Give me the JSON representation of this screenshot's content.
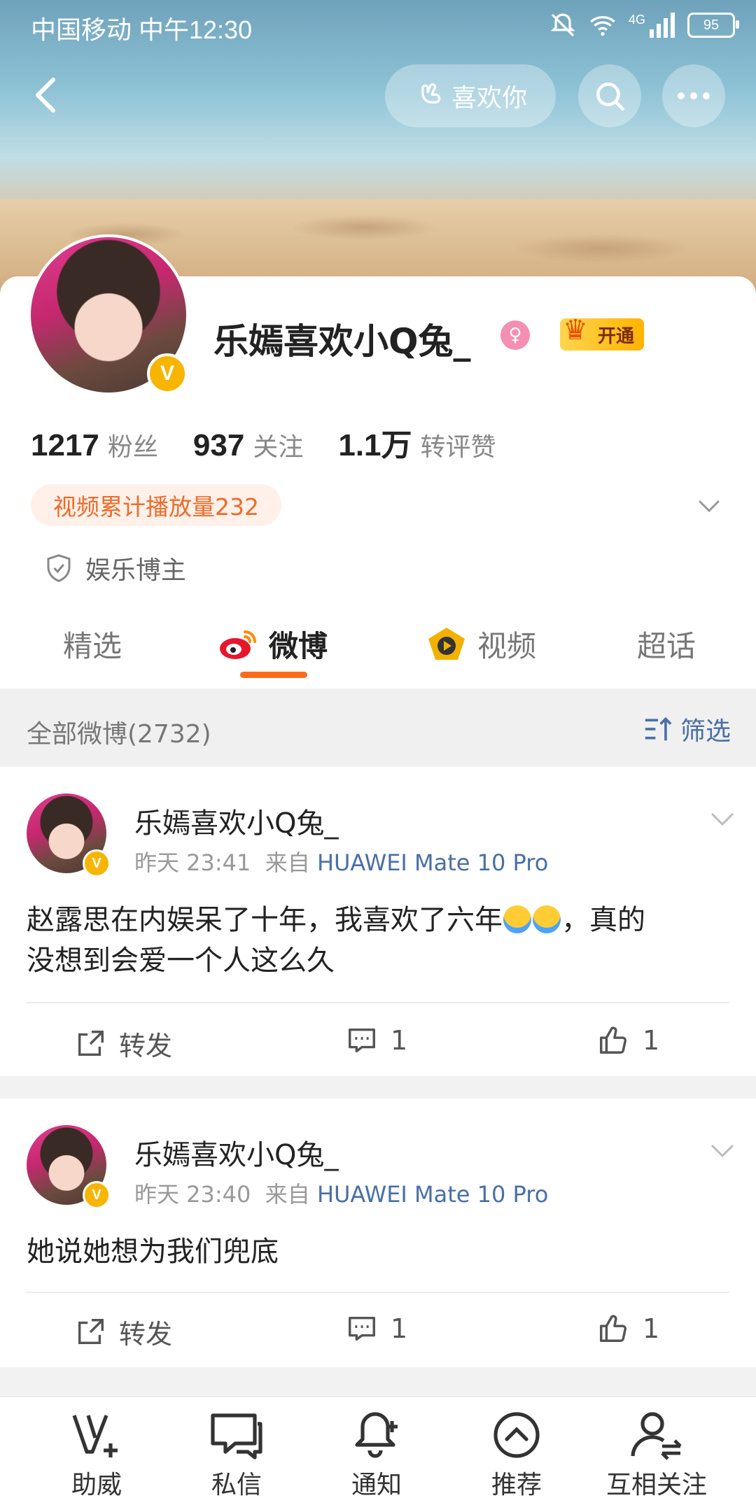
{
  "status": {
    "carrier_time": "中国移动 中午12:30",
    "battery": "95",
    "network": "4G"
  },
  "header": {
    "like_button": "喜欢你"
  },
  "profile": {
    "name": "乐嫣喜欢小Q兔_",
    "vip_label": "开通",
    "stats": [
      {
        "num": "1217",
        "label": "粉丝"
      },
      {
        "num": "937",
        "label": "关注"
      },
      {
        "num": "1.1万",
        "label": "转评赞"
      }
    ],
    "video_plays": "视频累计播放量232",
    "category": "娱乐博主"
  },
  "tabs": [
    "精选",
    "微博",
    "视频",
    "超话"
  ],
  "filter": {
    "title": "全部微博(2732)",
    "button": "筛选"
  },
  "posts": [
    {
      "name": "乐嫣喜欢小Q兔_",
      "time": "昨天 23:41",
      "from": "来自",
      "source": "HUAWEI Mate 10 Pro",
      "text_a": "赵露思在内娱呆了十年，我喜欢了六年",
      "text_b": "，真的",
      "text_c": "没想到会爱一个人这么久",
      "repost": "转发",
      "comments": "1",
      "likes": "1"
    },
    {
      "name": "乐嫣喜欢小Q兔_",
      "time": "昨天 23:40",
      "from": "来自",
      "source": "HUAWEI Mate 10 Pro",
      "text": "她说她想为我们兜底",
      "repost": "转发",
      "comments": "1",
      "likes": "1"
    }
  ],
  "bottom_nav": [
    "助威",
    "私信",
    "通知",
    "推荐",
    "互相关注"
  ]
}
